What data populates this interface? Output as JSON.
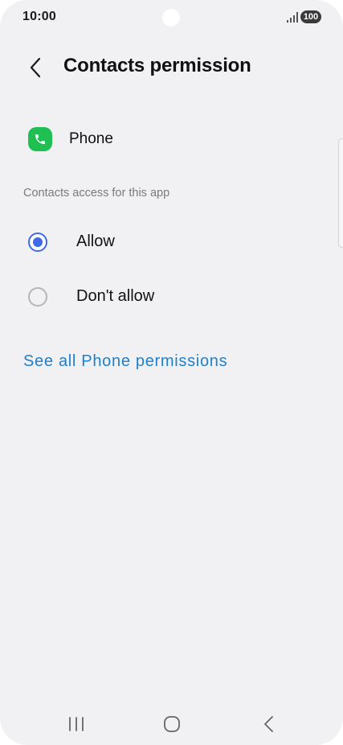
{
  "status_bar": {
    "time": "10:00",
    "battery": "100",
    "signal_icon": "signal-icon"
  },
  "header": {
    "back_icon": "chevron-left-icon",
    "title": "Contacts permission"
  },
  "app": {
    "name": "Phone",
    "icon": "phone-app-icon",
    "icon_color": "#1fbf52"
  },
  "section": {
    "label": "Contacts access for this app"
  },
  "options": [
    {
      "label": "Allow",
      "selected": true
    },
    {
      "label": "Don't allow",
      "selected": false
    }
  ],
  "link": {
    "label": "See all Phone permissions",
    "color": "#1f7fcf"
  },
  "accent_color": "#3d6be8",
  "nav_bar": {
    "recents_icon": "recents-icon",
    "home_icon": "home-icon",
    "back_icon": "back-icon"
  }
}
